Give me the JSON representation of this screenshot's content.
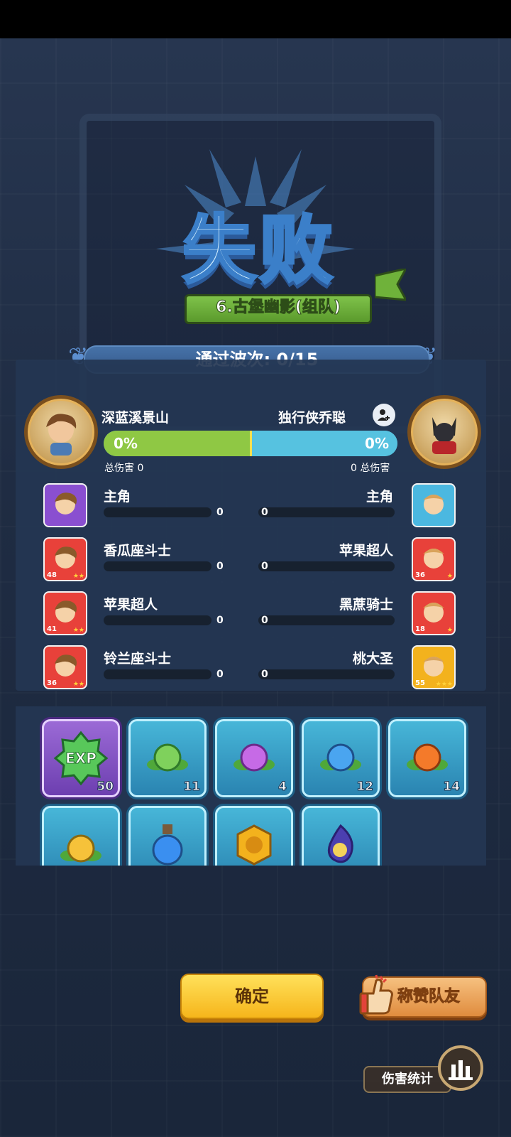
{
  "result": {
    "title": "失败",
    "stage": "6.古堡幽影(组队)",
    "waves": "通过波次: 0/15"
  },
  "players": {
    "left": {
      "name": "深蓝溪景山",
      "damage_pct": "0%",
      "total_label": "总伤害 0"
    },
    "right": {
      "name": "独行侠乔聪",
      "damage_pct": "0%",
      "total_label": "0 总伤害"
    },
    "damage_share_left": 0.5
  },
  "heroes_left": [
    {
      "name": "主角",
      "value": "0",
      "level": "",
      "stars": "",
      "color": "#8a4fd0"
    },
    {
      "name": "香瓜座斗士",
      "value": "0",
      "level": "48",
      "stars": "★★",
      "color": "#e8413a"
    },
    {
      "name": "苹果超人",
      "value": "0",
      "level": "41",
      "stars": "★★",
      "color": "#e8413a"
    },
    {
      "name": "铃兰座斗士",
      "value": "0",
      "level": "36",
      "stars": "★★",
      "color": "#e8413a"
    }
  ],
  "heroes_right": [
    {
      "name": "主角",
      "value": "0",
      "level": "",
      "stars": "",
      "color": "#4bb8e0"
    },
    {
      "name": "苹果超人",
      "value": "0",
      "level": "36",
      "stars": "★",
      "color": "#e8413a"
    },
    {
      "name": "黑蔗骑士",
      "value": "0",
      "level": "18",
      "stars": "★",
      "color": "#e8413a"
    },
    {
      "name": "桃大圣",
      "value": "0",
      "level": "55",
      "stars": "★★★",
      "color": "#f3b21d"
    }
  ],
  "rewards": [
    {
      "label": "EXP",
      "count": "50",
      "icon": "exp-icon"
    },
    {
      "label": "",
      "count": "11",
      "icon": "green-seed-icon"
    },
    {
      "label": "",
      "count": "4",
      "icon": "purple-seed-icon"
    },
    {
      "label": "",
      "count": "12",
      "icon": "blue-seed-icon"
    },
    {
      "label": "",
      "count": "14",
      "icon": "fire-seed-icon"
    },
    {
      "label": "",
      "count": "",
      "icon": "gold-seed-icon"
    },
    {
      "label": "",
      "count": "",
      "icon": "potion-icon"
    },
    {
      "label": "",
      "count": "",
      "icon": "coin-icon"
    },
    {
      "label": "",
      "count": "",
      "icon": "flame-orb-icon"
    }
  ],
  "buttons": {
    "confirm": "确定",
    "praise": "称赞队友",
    "stats": "伤害统计"
  }
}
